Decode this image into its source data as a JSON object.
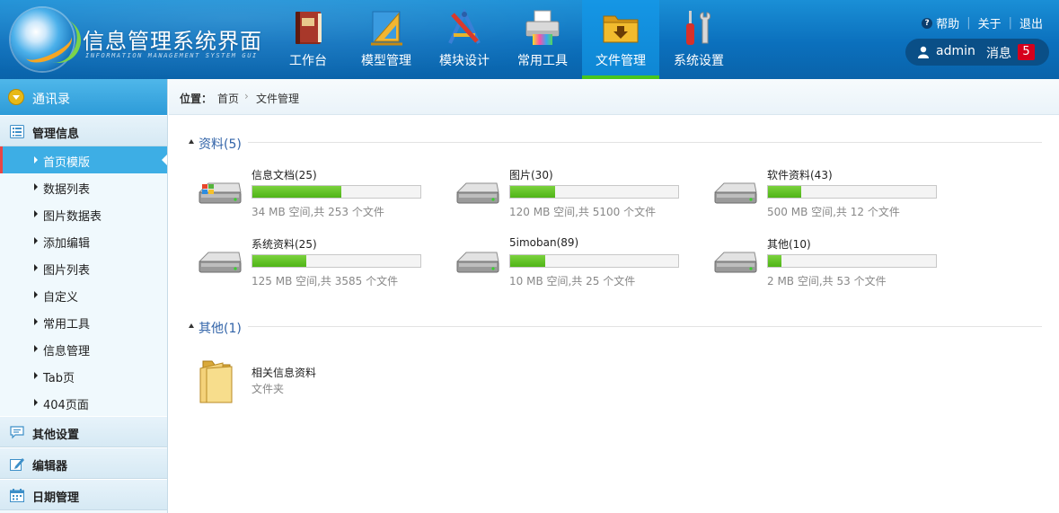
{
  "header": {
    "title": "信息管理系统界面",
    "subtitle": "INFORMATION MANAGEMENT SYSTEM GUI",
    "nav": [
      {
        "label": "工作台",
        "icon": "book-icon"
      },
      {
        "label": "模型管理",
        "icon": "ruler-triangle-icon"
      },
      {
        "label": "模块设计",
        "icon": "design-tools-icon"
      },
      {
        "label": "常用工具",
        "icon": "printer-icon"
      },
      {
        "label": "文件管理",
        "icon": "folder-download-icon",
        "active": true
      },
      {
        "label": "系统设置",
        "icon": "wrench-screwdriver-icon"
      }
    ],
    "top_links": {
      "help": "帮助",
      "about": "关于",
      "logout": "退出"
    },
    "user": {
      "name": "admin",
      "msg_label": "消息",
      "msg_count": "5"
    }
  },
  "sidebar": {
    "top": "通讯录",
    "sections": [
      {
        "label": "管理信息",
        "icon": "list-icon"
      },
      {
        "label": "其他设置",
        "icon": "chat-icon"
      },
      {
        "label": "编辑器",
        "icon": "edit-icon"
      },
      {
        "label": "日期管理",
        "icon": "calendar-icon"
      }
    ],
    "items": [
      {
        "label": "首页模版",
        "active": true
      },
      {
        "label": "数据列表"
      },
      {
        "label": "图片数据表"
      },
      {
        "label": "添加编辑"
      },
      {
        "label": "图片列表"
      },
      {
        "label": "自定义"
      },
      {
        "label": "常用工具"
      },
      {
        "label": "信息管理"
      },
      {
        "label": "Tab页"
      },
      {
        "label": "404页面"
      }
    ]
  },
  "breadcrumb": {
    "label": "位置：",
    "home": "首页",
    "separator": "›",
    "current": "文件管理"
  },
  "groups": {
    "data": {
      "title": "资料(5)"
    },
    "other": {
      "title": "其他(1)"
    }
  },
  "drives": [
    {
      "name": "信息文档(25)",
      "info": "34 MB 空间,共 253 个文件",
      "usage": 0.53,
      "os_drive": true
    },
    {
      "name": "图片(30)",
      "info": "120 MB 空间,共 5100 个文件",
      "usage": 0.27
    },
    {
      "name": "软件资料(43)",
      "info": "500 MB 空间,共 12 个文件",
      "usage": 0.2
    },
    {
      "name": "系统资料(25)",
      "info": "125 MB 空间,共 3585 个文件",
      "usage": 0.32
    },
    {
      "name": "5imoban(89)",
      "info": "10 MB 空间,共 25 个文件",
      "usage": 0.21
    },
    {
      "name": "其他(10)",
      "info": "2 MB 空间,共 53 个文件",
      "usage": 0.08
    }
  ],
  "folder": {
    "name": "相关信息资料",
    "type": "文件夹"
  },
  "colors": {
    "header_blue": "#0b70bd",
    "active_green": "#47c51e",
    "sidebar_active": "#3daee5",
    "progress_green": "#4fb417",
    "badge_red": "#d6001c"
  }
}
